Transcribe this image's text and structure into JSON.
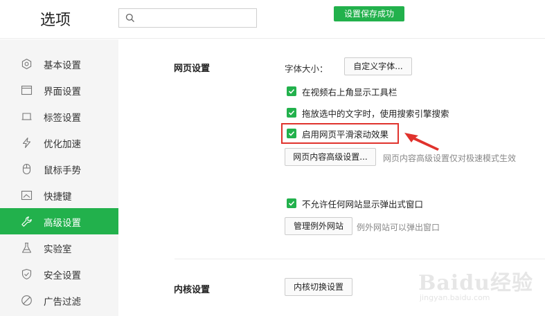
{
  "header": {
    "title": "选项",
    "search": {
      "value": "",
      "placeholder": ""
    },
    "toast": "设置保存成功"
  },
  "sidebar": {
    "items": [
      {
        "label": "基本设置",
        "icon": "settings-circle-icon",
        "active": false
      },
      {
        "label": "界面设置",
        "icon": "window-icon",
        "active": false
      },
      {
        "label": "标签设置",
        "icon": "tab-icon",
        "active": false
      },
      {
        "label": "优化加速",
        "icon": "lightning-icon",
        "active": false
      },
      {
        "label": "鼠标手势",
        "icon": "mouse-icon",
        "active": false
      },
      {
        "label": "快捷键",
        "icon": "keyboard-icon",
        "active": false
      },
      {
        "label": "高级设置",
        "icon": "wrench-icon",
        "active": true
      },
      {
        "label": "实验室",
        "icon": "flask-icon",
        "active": false
      },
      {
        "label": "安全设置",
        "icon": "shield-icon",
        "active": false
      },
      {
        "label": "广告过滤",
        "icon": "block-icon",
        "active": false
      }
    ]
  },
  "web_settings": {
    "section_title": "网页设置",
    "font_size_label": "字体大小：",
    "font_button": "自定义字体...",
    "options": [
      {
        "label": "在视频右上角显示工具栏",
        "checked": true
      },
      {
        "label": "拖放选中的文字时，使用搜索引擎搜索",
        "checked": true
      },
      {
        "label": "启用网页平滑滚动效果",
        "checked": true
      }
    ],
    "advanced_button": "网页内容高级设置...",
    "advanced_hint": "网页内容高级设置仅对极速模式生效",
    "popup_option": {
      "label": "不允许任何网站显示弹出式窗口",
      "checked": true
    },
    "exceptions_button": "管理例外网站",
    "exceptions_hint": "例外网站可以弹出窗口"
  },
  "kernel_settings": {
    "section_title": "内核设置",
    "switch_button": "内核切换设置"
  },
  "watermark": {
    "main": "Baidu经验",
    "sub": "jingyan.baidu.com"
  },
  "colors": {
    "accent": "#22b14c",
    "highlight": "#e0322c",
    "sidebar_bg": "#f5f5f5"
  }
}
